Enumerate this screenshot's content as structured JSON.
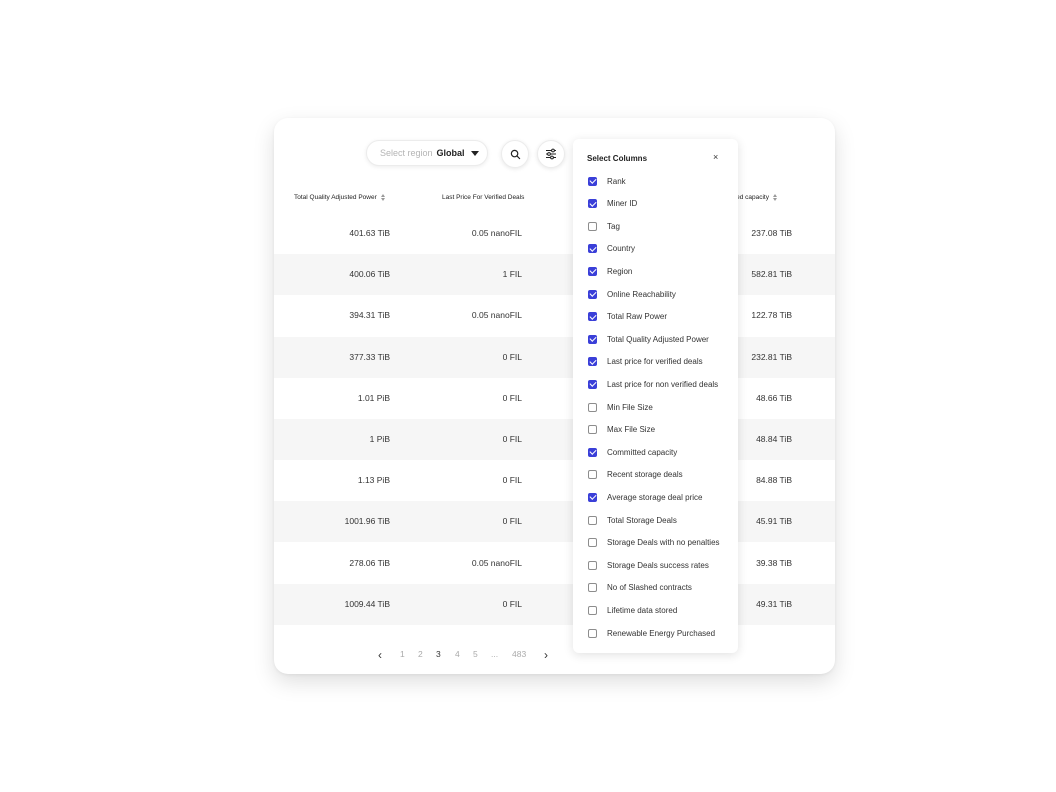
{
  "toolbar": {
    "region_placeholder": "Select region",
    "region_value": "Global",
    "search_icon": "search-icon",
    "filter_icon": "sliders-icon"
  },
  "table": {
    "headers": {
      "qap": "Total Quality Adjusted Power",
      "verified_price": "Last Price For Verified Deals",
      "committed": "...nitted capacity"
    },
    "rows": [
      {
        "qap": "401.63 TiB",
        "price": "0.05 nanoFIL",
        "committed": "237.08 TiB"
      },
      {
        "qap": "400.06 TiB",
        "price": "1 FIL",
        "committed": "582.81 TiB"
      },
      {
        "qap": "394.31 TiB",
        "price": "0.05 nanoFIL",
        "committed": "122.78 TiB"
      },
      {
        "qap": "377.33 TiB",
        "price": "0 FIL",
        "committed": "232.81 TiB"
      },
      {
        "qap": "1.01 PiB",
        "price": "0 FIL",
        "committed": "48.66 TiB"
      },
      {
        "qap": "1 PiB",
        "price": "0 FIL",
        "committed": "48.84 TiB"
      },
      {
        "qap": "1.13 PiB",
        "price": "0 FIL",
        "committed": "84.88 TiB"
      },
      {
        "qap": "1001.96 TiB",
        "price": "0 FIL",
        "committed": "45.91 TiB"
      },
      {
        "qap": "278.06 TiB",
        "price": "0.05 nanoFIL",
        "committed": "39.38 TiB"
      },
      {
        "qap": "1009.44 TiB",
        "price": "0 FIL",
        "committed": "49.31 TiB"
      }
    ]
  },
  "pagination": {
    "prev": "‹",
    "pages": [
      "1",
      "2",
      "3",
      "4",
      "5",
      "...",
      "483"
    ],
    "current": "3",
    "next": "›"
  },
  "column_selector": {
    "title": "Select Columns",
    "close": "×",
    "options": [
      {
        "label": "Rank",
        "checked": true
      },
      {
        "label": "Miner ID",
        "checked": true
      },
      {
        "label": "Tag",
        "checked": false
      },
      {
        "label": "Country",
        "checked": true
      },
      {
        "label": "Region",
        "checked": true
      },
      {
        "label": "Online Reachability",
        "checked": true
      },
      {
        "label": "Total Raw Power",
        "checked": true
      },
      {
        "label": "Total Quality Adjusted Power",
        "checked": true
      },
      {
        "label": "Last price for verified deals",
        "checked": true
      },
      {
        "label": "Last price for non verified deals",
        "checked": true
      },
      {
        "label": "Min File Size",
        "checked": false
      },
      {
        "label": "Max File Size",
        "checked": false
      },
      {
        "label": "Committed capacity",
        "checked": true
      },
      {
        "label": "Recent storage deals",
        "checked": false
      },
      {
        "label": "Average storage deal price",
        "checked": true
      },
      {
        "label": "Total Storage Deals",
        "checked": false
      },
      {
        "label": "Storage Deals with no penalties",
        "checked": false
      },
      {
        "label": "Storage Deals success rates",
        "checked": false
      },
      {
        "label": "No of Slashed contracts",
        "checked": false
      },
      {
        "label": "Lifetime data stored",
        "checked": false
      },
      {
        "label": "Renewable Energy Purchased",
        "checked": false
      }
    ]
  },
  "colors": {
    "accent": "#3a3fd8",
    "row_alt": "#f6f6f6"
  }
}
